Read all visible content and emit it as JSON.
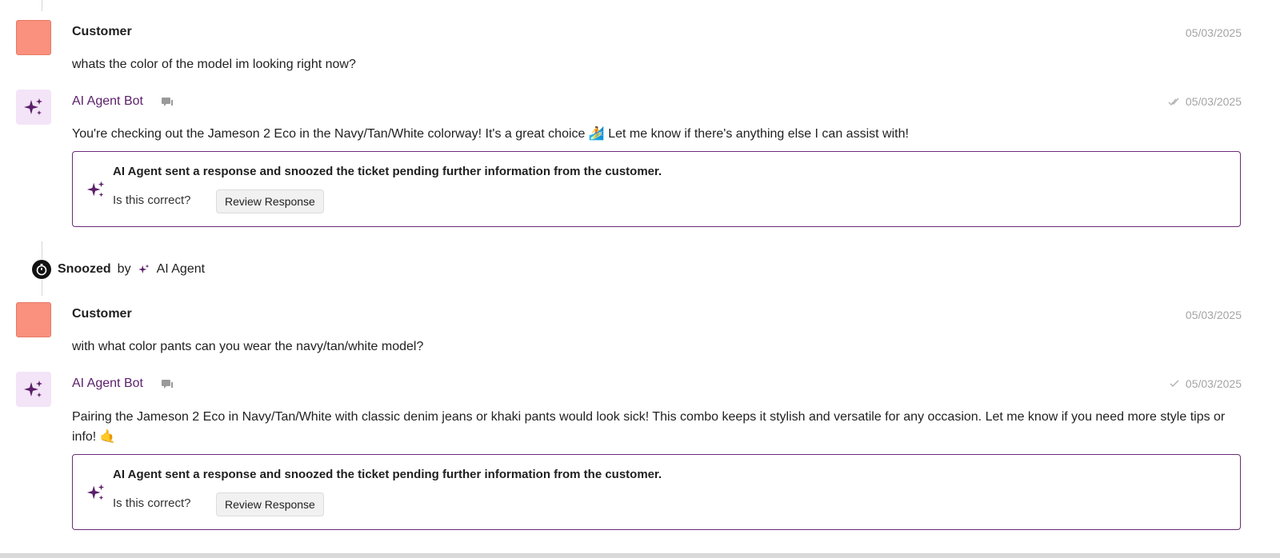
{
  "colors": {
    "accent": "#6b2a7a",
    "customer_avatar": "#f9917e",
    "bot_avatar_bg": "#f3e4f7"
  },
  "messages": [
    {
      "author": "Customer",
      "timestamp": "05/03/2025",
      "text": "whats the color of the model im looking right now?"
    },
    {
      "author": "AI Agent Bot",
      "timestamp": "05/03/2025",
      "status_icon": "double-check-icon",
      "text": "You're checking out the Jameson 2 Eco in the Navy/Tan/White colorway! It's a great choice 🏄 Let me know if there's anything else I can assist with!",
      "notice": {
        "title": "AI Agent sent a response and snoozed the ticket pending further information from the customer.",
        "question": "Is this correct?",
        "button": "Review Response"
      }
    },
    {
      "author": "Customer",
      "timestamp": "05/03/2025",
      "text": "with what color pants can you wear the navy/tan/white model?"
    },
    {
      "author": "AI Agent Bot",
      "timestamp": "05/03/2025",
      "status_icon": "check-icon",
      "text": "Pairing the Jameson 2 Eco in Navy/Tan/White with classic denim jeans or khaki pants would look sick! This combo keeps it stylish and versatile for any occasion. Let me know if you need more style tips or info! 🤙",
      "notice": {
        "title": "AI Agent sent a response and snoozed the ticket pending further information from the customer.",
        "question": "Is this correct?",
        "button": "Review Response"
      }
    }
  ],
  "event": {
    "label": "Snoozed",
    "by": "by",
    "actor": "AI Agent"
  }
}
